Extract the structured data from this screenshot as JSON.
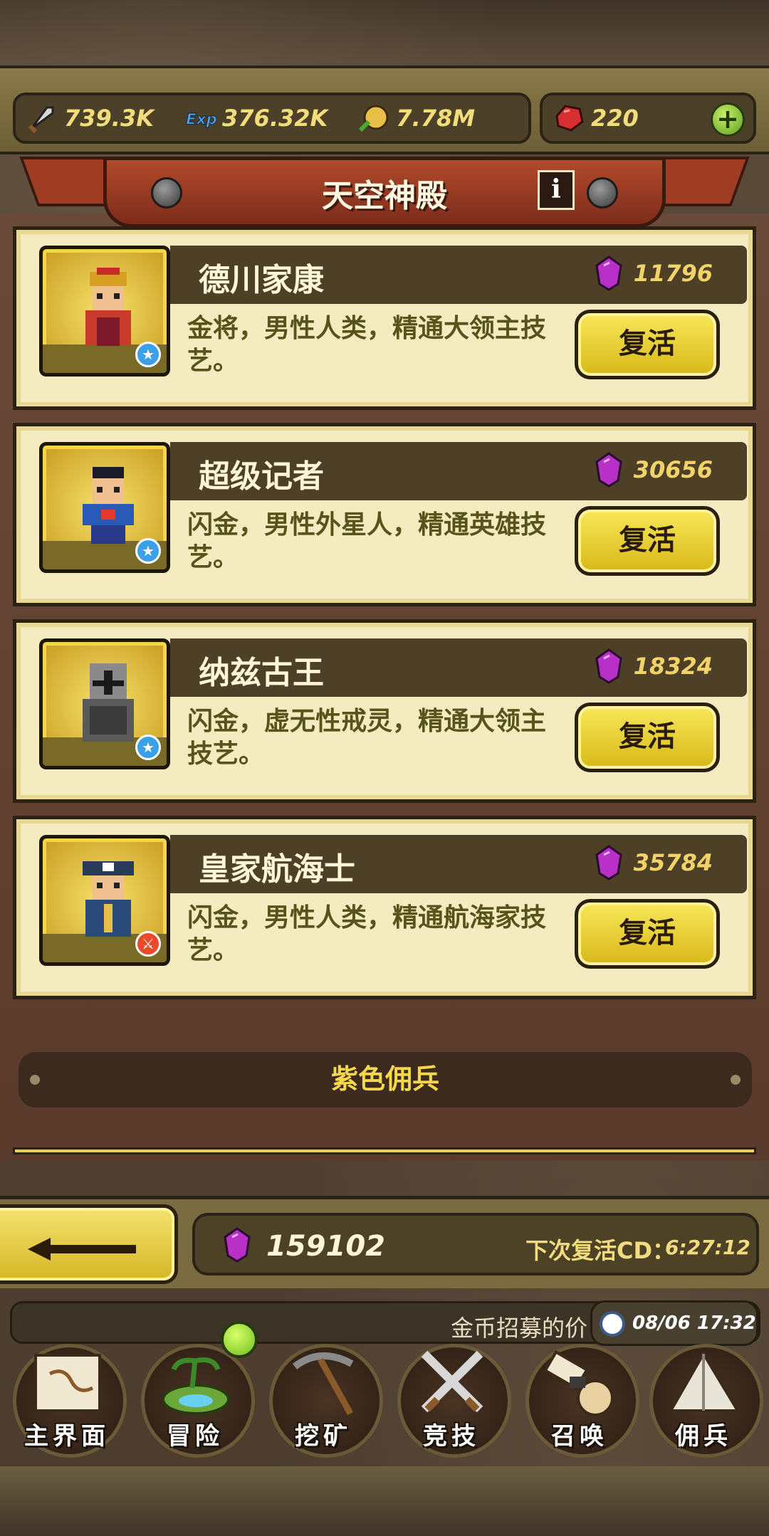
{
  "resources": {
    "attack": "739.3K",
    "exp": "376.32K",
    "gold": "7.78M",
    "ruby": "220"
  },
  "title": "天空神殿",
  "info_label": "i",
  "heroes": [
    {
      "name": "德川家康",
      "cost": "11796",
      "desc": "金将，男性人类，精通大领主技艺。",
      "button": "复活",
      "badge": "star",
      "armor": "#c83a2a"
    },
    {
      "name": "超级记者",
      "cost": "30656",
      "desc": "闪金，男性外星人，精通英雄技艺。",
      "button": "复活",
      "badge": "star",
      "armor": "#2a5ab8"
    },
    {
      "name": "纳兹古王",
      "cost": "18324",
      "desc": "闪金，虚无性戒灵，精通大领主技艺。",
      "button": "复活",
      "badge": "star",
      "armor": "#6a6a6a"
    },
    {
      "name": "皇家航海士",
      "cost": "35784",
      "desc": "闪金，男性人类，精通航海家技艺。",
      "button": "复活",
      "badge": "sword",
      "armor": "#2a4a7a"
    }
  ],
  "section_title": "紫色佣兵",
  "total_gems": "159102",
  "cooldown_label": "下次复活CD：",
  "cooldown_value": "6:27:12",
  "ticker_text": "金币招募的价",
  "clock_time": "08/06 17:32",
  "nav": [
    {
      "label": "主界面",
      "icon": "map-scroll-icon"
    },
    {
      "label": "冒险",
      "icon": "island-icon"
    },
    {
      "label": "挖矿",
      "icon": "pickaxe-icon"
    },
    {
      "label": "竞技",
      "icon": "crossed-swords-icon"
    },
    {
      "label": "召唤",
      "icon": "summon-scroll-icon"
    },
    {
      "label": "佣兵",
      "icon": "tent-icon"
    }
  ]
}
